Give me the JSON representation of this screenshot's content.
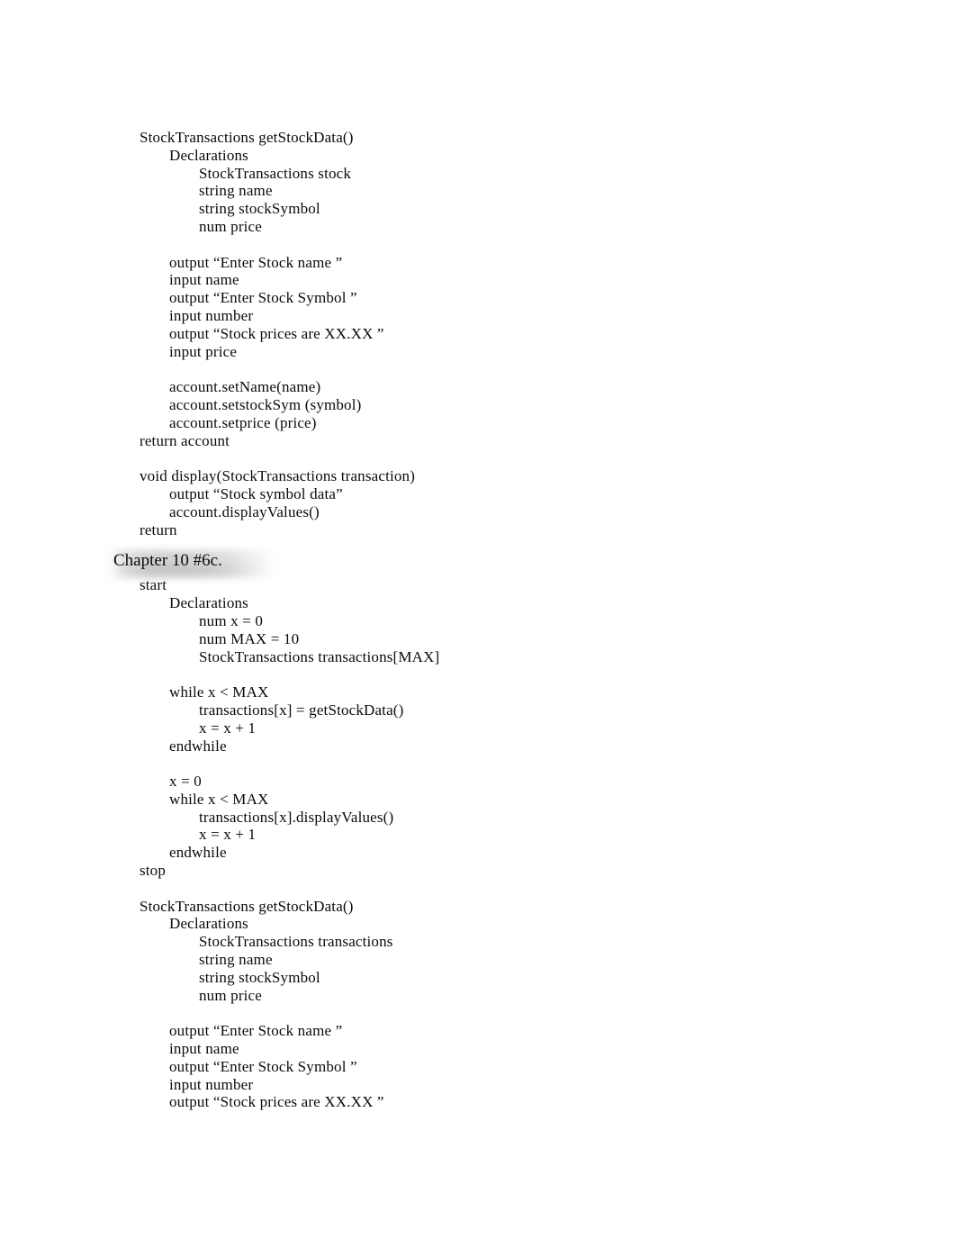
{
  "document": {
    "heading": "Chapter 10 #6c.",
    "blocks": [
      {
        "name": "get-stock-data-method-top",
        "lines": [
          {
            "indent": 0,
            "text": "StockTransactions getStockData()"
          },
          {
            "indent": 1,
            "text": "Declarations"
          },
          {
            "indent": 2,
            "text": "StockTransactions stock"
          },
          {
            "indent": 2,
            "text": "string name"
          },
          {
            "indent": 2,
            "text": "string stockSymbol"
          },
          {
            "indent": 2,
            "text": "num price"
          },
          {
            "indent": 0,
            "text": ""
          },
          {
            "indent": 1,
            "text": "output “Enter Stock name ”"
          },
          {
            "indent": 1,
            "text": "input name"
          },
          {
            "indent": 1,
            "text": "output “Enter Stock Symbol ”"
          },
          {
            "indent": 1,
            "text": "input number"
          },
          {
            "indent": 1,
            "text": "output “Stock prices are XX.XX ”"
          },
          {
            "indent": 1,
            "text": "input price"
          },
          {
            "indent": 0,
            "text": ""
          },
          {
            "indent": 1,
            "text": "account.setName(name)"
          },
          {
            "indent": 1,
            "text": "account.setstockSym (symbol)"
          },
          {
            "indent": 1,
            "text": "account.setprice (price)"
          },
          {
            "indent": 0,
            "text": "return account"
          },
          {
            "indent": 0,
            "text": ""
          },
          {
            "indent": 0,
            "text": "void display(StockTransactions transaction)"
          },
          {
            "indent": 1,
            "text": "output “Stock symbol data”"
          },
          {
            "indent": 1,
            "text": "account.displayValues()"
          },
          {
            "indent": 0,
            "text": "return"
          }
        ]
      },
      {
        "name": "chapter-10-6c-main",
        "lines": [
          {
            "indent": 0,
            "text": "start"
          },
          {
            "indent": 1,
            "text": "Declarations"
          },
          {
            "indent": 2,
            "text": "num x = 0"
          },
          {
            "indent": 2,
            "text": "num MAX = 10"
          },
          {
            "indent": 2,
            "text": "StockTransactions transactions[MAX]"
          },
          {
            "indent": 0,
            "text": ""
          },
          {
            "indent": 1,
            "text": "while x < MAX"
          },
          {
            "indent": 2,
            "text": "transactions[x] = getStockData()"
          },
          {
            "indent": 2,
            "text": "x = x + 1"
          },
          {
            "indent": 1,
            "text": "endwhile"
          },
          {
            "indent": 0,
            "text": ""
          },
          {
            "indent": 1,
            "text": "x = 0"
          },
          {
            "indent": 1,
            "text": "while x < MAX"
          },
          {
            "indent": 2,
            "text": "transactions[x].displayValues()"
          },
          {
            "indent": 2,
            "text": "x = x + 1"
          },
          {
            "indent": 1,
            "text": "endwhile"
          },
          {
            "indent": 0,
            "text": "stop"
          },
          {
            "indent": 0,
            "text": ""
          },
          {
            "indent": 0,
            "text": "StockTransactions getStockData()"
          },
          {
            "indent": 1,
            "text": "Declarations"
          },
          {
            "indent": 2,
            "text": "StockTransactions transactions"
          },
          {
            "indent": 2,
            "text": "string name"
          },
          {
            "indent": 2,
            "text": "string stockSymbol"
          },
          {
            "indent": 2,
            "text": "num price"
          },
          {
            "indent": 0,
            "text": ""
          },
          {
            "indent": 1,
            "text": "output “Enter Stock name ”"
          },
          {
            "indent": 1,
            "text": "input name"
          },
          {
            "indent": 1,
            "text": "output “Enter Stock Symbol ”"
          },
          {
            "indent": 1,
            "text": "input number"
          },
          {
            "indent": 1,
            "text": "output “Stock prices are XX.XX ”"
          }
        ]
      }
    ]
  }
}
